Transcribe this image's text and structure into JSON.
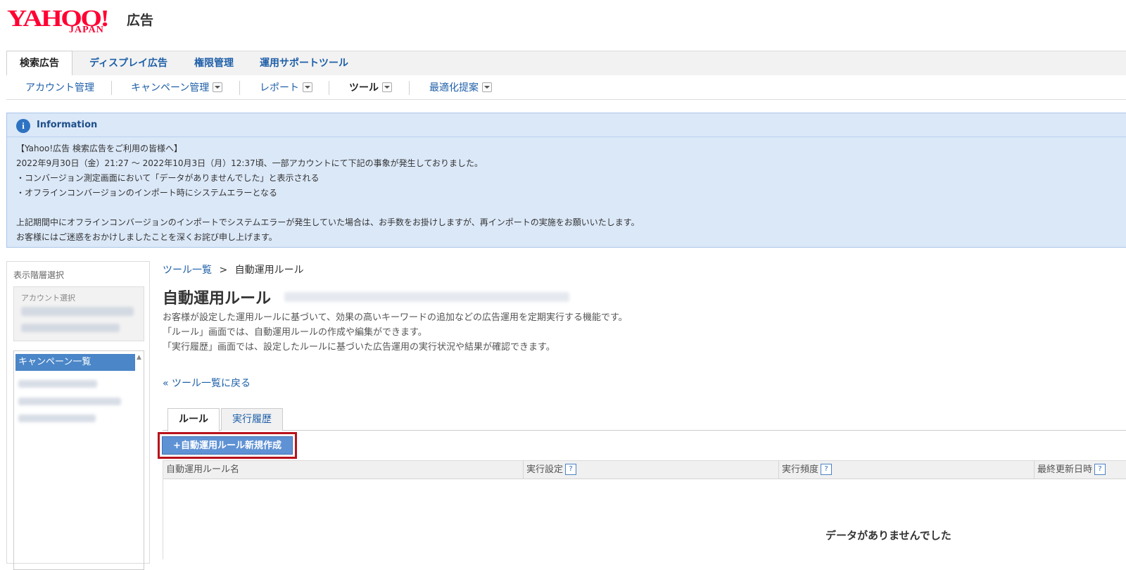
{
  "brand": {
    "logo_text": "YAHOO!",
    "logo_sub": "JAPAN",
    "product": "広告",
    "accent": "#ff0033"
  },
  "top_tabs": [
    {
      "label": "検索広告",
      "active": true
    },
    {
      "label": "ディスプレイ広告",
      "active": false
    },
    {
      "label": "権限管理",
      "active": false
    },
    {
      "label": "運用サポートツール",
      "active": false
    }
  ],
  "sub_nav": [
    {
      "label": "アカウント管理",
      "dropdown": false
    },
    {
      "label": "キャンペーン管理",
      "dropdown": true
    },
    {
      "label": "レポート",
      "dropdown": true
    },
    {
      "label": "ツール",
      "dropdown": true,
      "active": true
    },
    {
      "label": "最適化提案",
      "dropdown": true
    }
  ],
  "info": {
    "icon": "info-icon",
    "title": "Information",
    "lines": [
      "【Yahoo!広告 検索広告をご利用の皆様へ】",
      "2022年9月30日（金）21:27 ～ 2022年10月3日（月）12:37頃、一部アカウントにて下記の事象が発生しておりました。",
      "・コンバージョン測定画面において「データがありませんでした」と表示される",
      "・オフラインコンバージョンのインポート時にシステムエラーとなる",
      "",
      "上記期間中にオフラインコンバージョンのインポートでシステムエラーが発生していた場合は、お手数をお掛けしますが、再インポートの実施をお願いいたします。",
      "お客様にはご迷惑をおかけしましたことを深くお詫び申し上げます。"
    ]
  },
  "left_panel": {
    "title": "表示階層選択",
    "account_label": "アカウント選択",
    "campaign_header": "キャンペーン一覧"
  },
  "breadcrumb": {
    "parent": "ツール一覧",
    "separator": ">",
    "current": "自動運用ルール"
  },
  "page": {
    "title": "自動運用ルール",
    "desc": [
      "お客様が設定した運用ルールに基づいて、効果の高いキーワードの追加などの広告運用を定期実行する機能です。",
      "「ルール」画面では、自動運用ルールの作成や編集ができます。",
      "「実行履歴」画面では、設定したルールに基づいた広告運用の実行状況や結果が確認できます。"
    ],
    "back_link": "« ツール一覧に戻る"
  },
  "content_tabs": [
    {
      "label": "ルール",
      "active": true
    },
    {
      "label": "実行履歴",
      "active": false
    }
  ],
  "new_button": "+自動運用ルール新規作成",
  "table": {
    "columns": [
      {
        "label": "自動運用ルール名",
        "help": false
      },
      {
        "label": "実行設定",
        "help": true
      },
      {
        "label": "実行頻度",
        "help": true
      },
      {
        "label": "最終更新日時",
        "help": true
      }
    ],
    "help_glyph": "?",
    "empty_message": "データがありませんでした"
  }
}
